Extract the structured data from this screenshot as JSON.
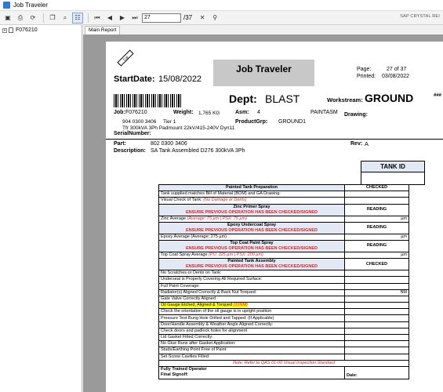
{
  "window": {
    "title": "Job Traveler",
    "brand": "SAP CRYSTAL REI"
  },
  "toolbar": {
    "page_value": "27",
    "page_total": "/37"
  },
  "tree": {
    "item": "F076210"
  },
  "tab": {
    "label": "Main Report"
  },
  "report": {
    "title": "Job Traveler",
    "logo_text": "Cat",
    "page_label": "Page:",
    "page_value": "27 of 37",
    "printed_label": "Printed:",
    "printed_value": "03/08/2022",
    "startdate_label": "StartDate:",
    "startdate_value": "15/08/2022",
    "dept_label": "Dept:",
    "dept_value": "BLAST",
    "workstream_label": "Workstream:",
    "workstream_value": "GROUND",
    "hash": "###",
    "job_label": "Job:",
    "job_value": "F076210",
    "weight_label": "Weight:",
    "weight_value": "1,765 KG",
    "asm_label": "Asm:",
    "asm_value": "4",
    "paintasm": "PAINTASM",
    "drawing_label": "Drawing:",
    "partno": "904 0300 3406",
    "tier": "Tier 1",
    "productgrp_label": "ProductGrp:",
    "productgrp_value": "GROUND1",
    "tfr": "Tfr 300kVA 3Ph Padmount 22kV/415-240V Dyn11",
    "serial_label": "SerialNumber:",
    "part_label": "Part:",
    "part_value": "802 0300 3406",
    "rev_label": "Rev:",
    "rev_value": "A",
    "desc_label": "Description:",
    "desc_value": "SA Tank Assembled D276 300kVA 3Ph",
    "tankid": "TANK ID",
    "rows": {
      "s1": "Painted Tank Preparation",
      "s1r": "CHECKED",
      "r1": "Tank supplied matches Bill of Material (BOM) and GA Drawing:",
      "r2a": "Visual Check of Tank: ",
      "r2b": "(No Damage or Dents)",
      "s2": "Zinc Primer Spray",
      "s2w": "ENSURE PREVIOUS OPERATION HAS BEEN CHECKED/SIGNED",
      "s2r": "READING",
      "r3a": "Zinc Average ",
      "r3b": "(Average: 75 µm | PSX: 75 µm)",
      "r3u": "µm",
      "s3": "Epoxy Undercoat Spray",
      "s3w": "ENSURE PREVIOUS OPERATION HAS BEEN CHECKED/SIGNED",
      "s3r": "READING",
      "r4": "Epoxy Average (Average: 275 µm)",
      "r4u": "µm",
      "s4": "Top Coat Paint Spray",
      "s4w": "ENSURE PREVIOUS OPERATION HAS BEEN CHECKED/SIGNED",
      "s4r": "READING",
      "r5a": "Top Coat Spray Average ",
      "r5b": "(PU: 325 µm | PSX: 200 µm)",
      "r5u": "µm",
      "s5": "Painted Tank Assembly",
      "s5w": "ENSURE PREVIOUS OPERATION HAS BEEN CHECKED/SIGNED",
      "s5r": "CHECKED",
      "r6": "No Scratches or Dents on Tank:",
      "r7": "Underseal is Properly Covering All Required Surface:",
      "r8": "Full Paint Coverage:",
      "r9": "Radiator(s) Aligned Correctly & Back Nut Torqued:",
      "r9u": "NM",
      "r10": "Gate Valve Correctly Aligned",
      "r11a": "Oil Gauge Etched, Aligned & Torqued ",
      "r11b": "(10NM)",
      "r12": "Check the orientation of the oil gauge is in upright position",
      "r13": "Pressure Test Bung Hole Drilled and Tapped: (If Applicable)",
      "r14": "Door/Handle Assembly & Weather Angle Aligned Correctly:",
      "r15": "Check doors and padlock holes for alignment",
      "r16": "Lid Gasket Fitted Correctly:",
      "r17": "No Glue Runs after Gasket Application:",
      "r18": "Studs/Earthing Point Free of Paint:",
      "r19": "Set Screw Cavities Filled:",
      "note": "Note: Refer to QAS 01-00 Visual Inspection Standard",
      "f1": "Fully Trained Operator",
      "f2": "Final Signoff:",
      "f2d": "Date:"
    }
  }
}
